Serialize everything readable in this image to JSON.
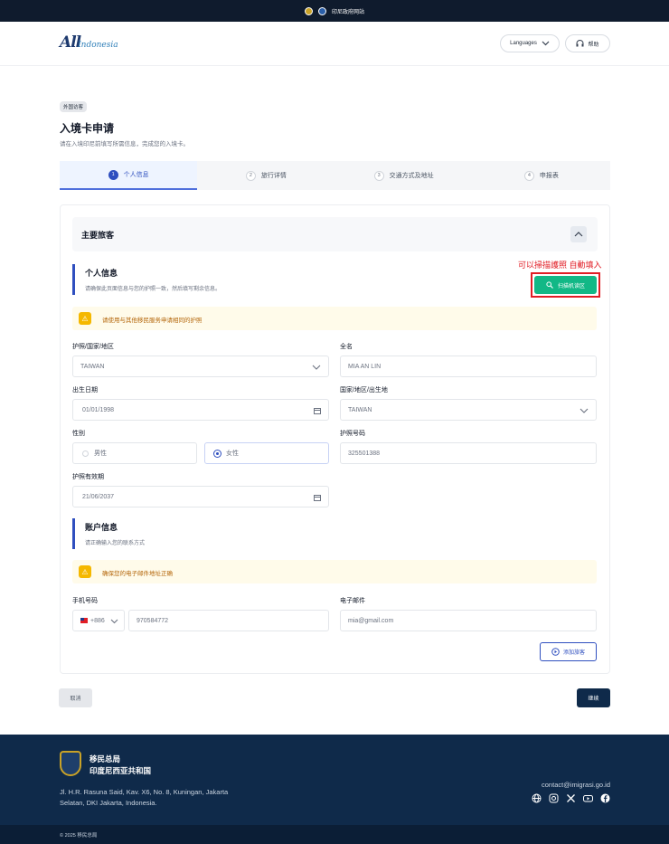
{
  "topbar": {
    "text": "印尼政府网站"
  },
  "header": {
    "logo_big": "All",
    "logo_small": "Indonesia",
    "languages_label": "Languages",
    "help_label": "帮助"
  },
  "page": {
    "badge": "外国访客",
    "title": "入境卡申请",
    "subtitle": "请在入境印尼前填写所需信息，完成您的入境卡。"
  },
  "steps": [
    {
      "num": "1",
      "label": "个人信息"
    },
    {
      "num": "2",
      "label": "旅行详情"
    },
    {
      "num": "3",
      "label": "交通方式及地址"
    },
    {
      "num": "4",
      "label": "申报表"
    }
  ],
  "main_section": {
    "title": "主要旅客"
  },
  "personal": {
    "title": "个人信息",
    "desc": "请确保此页面信息与您的护照一致，然后填写剩余信息。",
    "annotation": "可以掃描護照 自動填入",
    "scan_label": "扫描机读区",
    "alert": "请使用与其他移民服务申请相同的护照"
  },
  "form": {
    "passport_country_label": "护照/国家/地区",
    "passport_country_value": "TAIWAN",
    "fullname_label": "全名",
    "fullname_value": "MIA AN LIN",
    "dob_label": "出生日期",
    "dob_value": "01/01/1998",
    "birthplace_label": "国家/地区/出生地",
    "birthplace_value": "TAIWAN",
    "gender_label": "性别",
    "gender_male": "男性",
    "gender_female": "女性",
    "passport_no_label": "护照号码",
    "passport_no_value": "325501388",
    "expiry_label": "护照有效期",
    "expiry_value": "21/06/2037"
  },
  "account": {
    "title": "账户信息",
    "desc": "请正确输入您的联系方式",
    "alert": "确保您的电子邮件地址正确",
    "phone_label": "手机号码",
    "phone_code": "+886",
    "phone_value": "970584772",
    "email_label": "电子邮件",
    "email_value": "mia@gmail.com",
    "add_traveler": "添加旅客"
  },
  "actions": {
    "cancel": "取消",
    "continue": "继续"
  },
  "footer": {
    "agency_line1": "移民总局",
    "agency_line2": "印度尼西亚共和国",
    "address": "Jl. H.R. Rasuna Said, Kav. X6, No. 8, Kuningan, Jakarta Selatan, DKI Jakarta, Indonesia.",
    "email": "contact@imigrasi.go.id",
    "copyright": "© 2025 移民总局"
  },
  "colors": {
    "primary": "#2f4fbf",
    "scan_green": "#12b886",
    "annotation_red": "#e11d25",
    "footer_bg": "#0f2a4a"
  },
  "icons": [
    "globe-icon",
    "instagram-icon",
    "x-icon",
    "youtube-icon",
    "facebook-icon",
    "headset-icon",
    "search-icon",
    "calendar-icon",
    "chevron-down-icon",
    "warning-icon",
    "plus-circle-icon"
  ]
}
